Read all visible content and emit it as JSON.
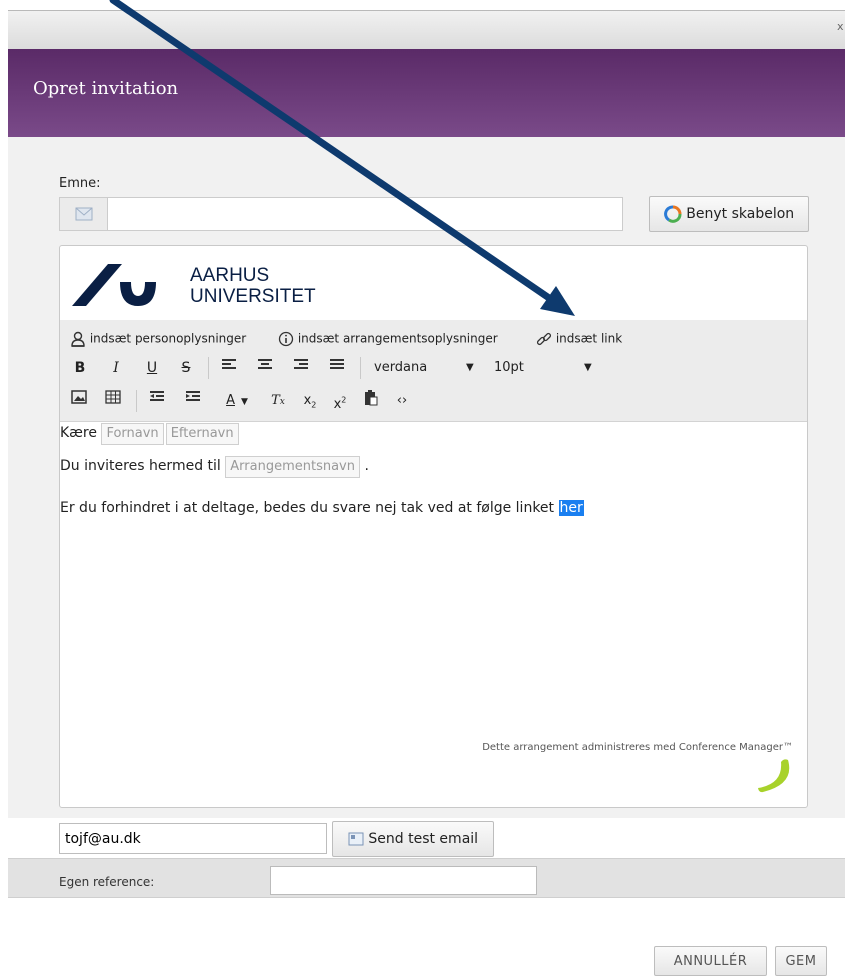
{
  "window": {
    "close_glyph": "x"
  },
  "dialog": {
    "title": "Opret invitation"
  },
  "subject": {
    "label": "Emne:",
    "value": "",
    "icon": "envelope-icon"
  },
  "template_button": {
    "label": "Benyt skabelon",
    "icon": "recycle-icon"
  },
  "editor": {
    "logo": {
      "line1": "AARHUS",
      "line2": "UNIVERSITET"
    },
    "insert_menu": [
      {
        "label": "indsæt personoplysninger",
        "icon": "person-icon"
      },
      {
        "label": "indsæt arrangementsoplysninger",
        "icon": "info-icon"
      },
      {
        "label": "indsæt link",
        "icon": "link-icon"
      }
    ],
    "format_buttons": [
      "B",
      "I",
      "U",
      "S"
    ],
    "font": "verdana",
    "font_size": "10pt",
    "content": {
      "greeting": "Kære",
      "placeholder_first_name": "Fornavn",
      "placeholder_last_name": "Efternavn",
      "invite_text": "Du inviteres hermed til",
      "placeholder_event_name": "Arrangementsnavn",
      "invite_suffix": ".",
      "decline_text": "Er du forhindret i at deltage, bedes du svare nej tak ved at følge linket",
      "link_text": "her"
    },
    "footer_note": "Dette arrangement administreres med Conference Manager™"
  },
  "test_email": {
    "value": "tojf@au.dk",
    "button_label": "Send test email"
  },
  "reference": {
    "label": "Egen reference:",
    "value": ""
  },
  "actions": {
    "cancel": "ANNULLÉR",
    "save": "GEM"
  },
  "colors": {
    "header": "#6b3a7a",
    "arrow": "#0e3a6e",
    "highlight": "#1a7ff0",
    "cm_logo": "#a8d22b"
  }
}
